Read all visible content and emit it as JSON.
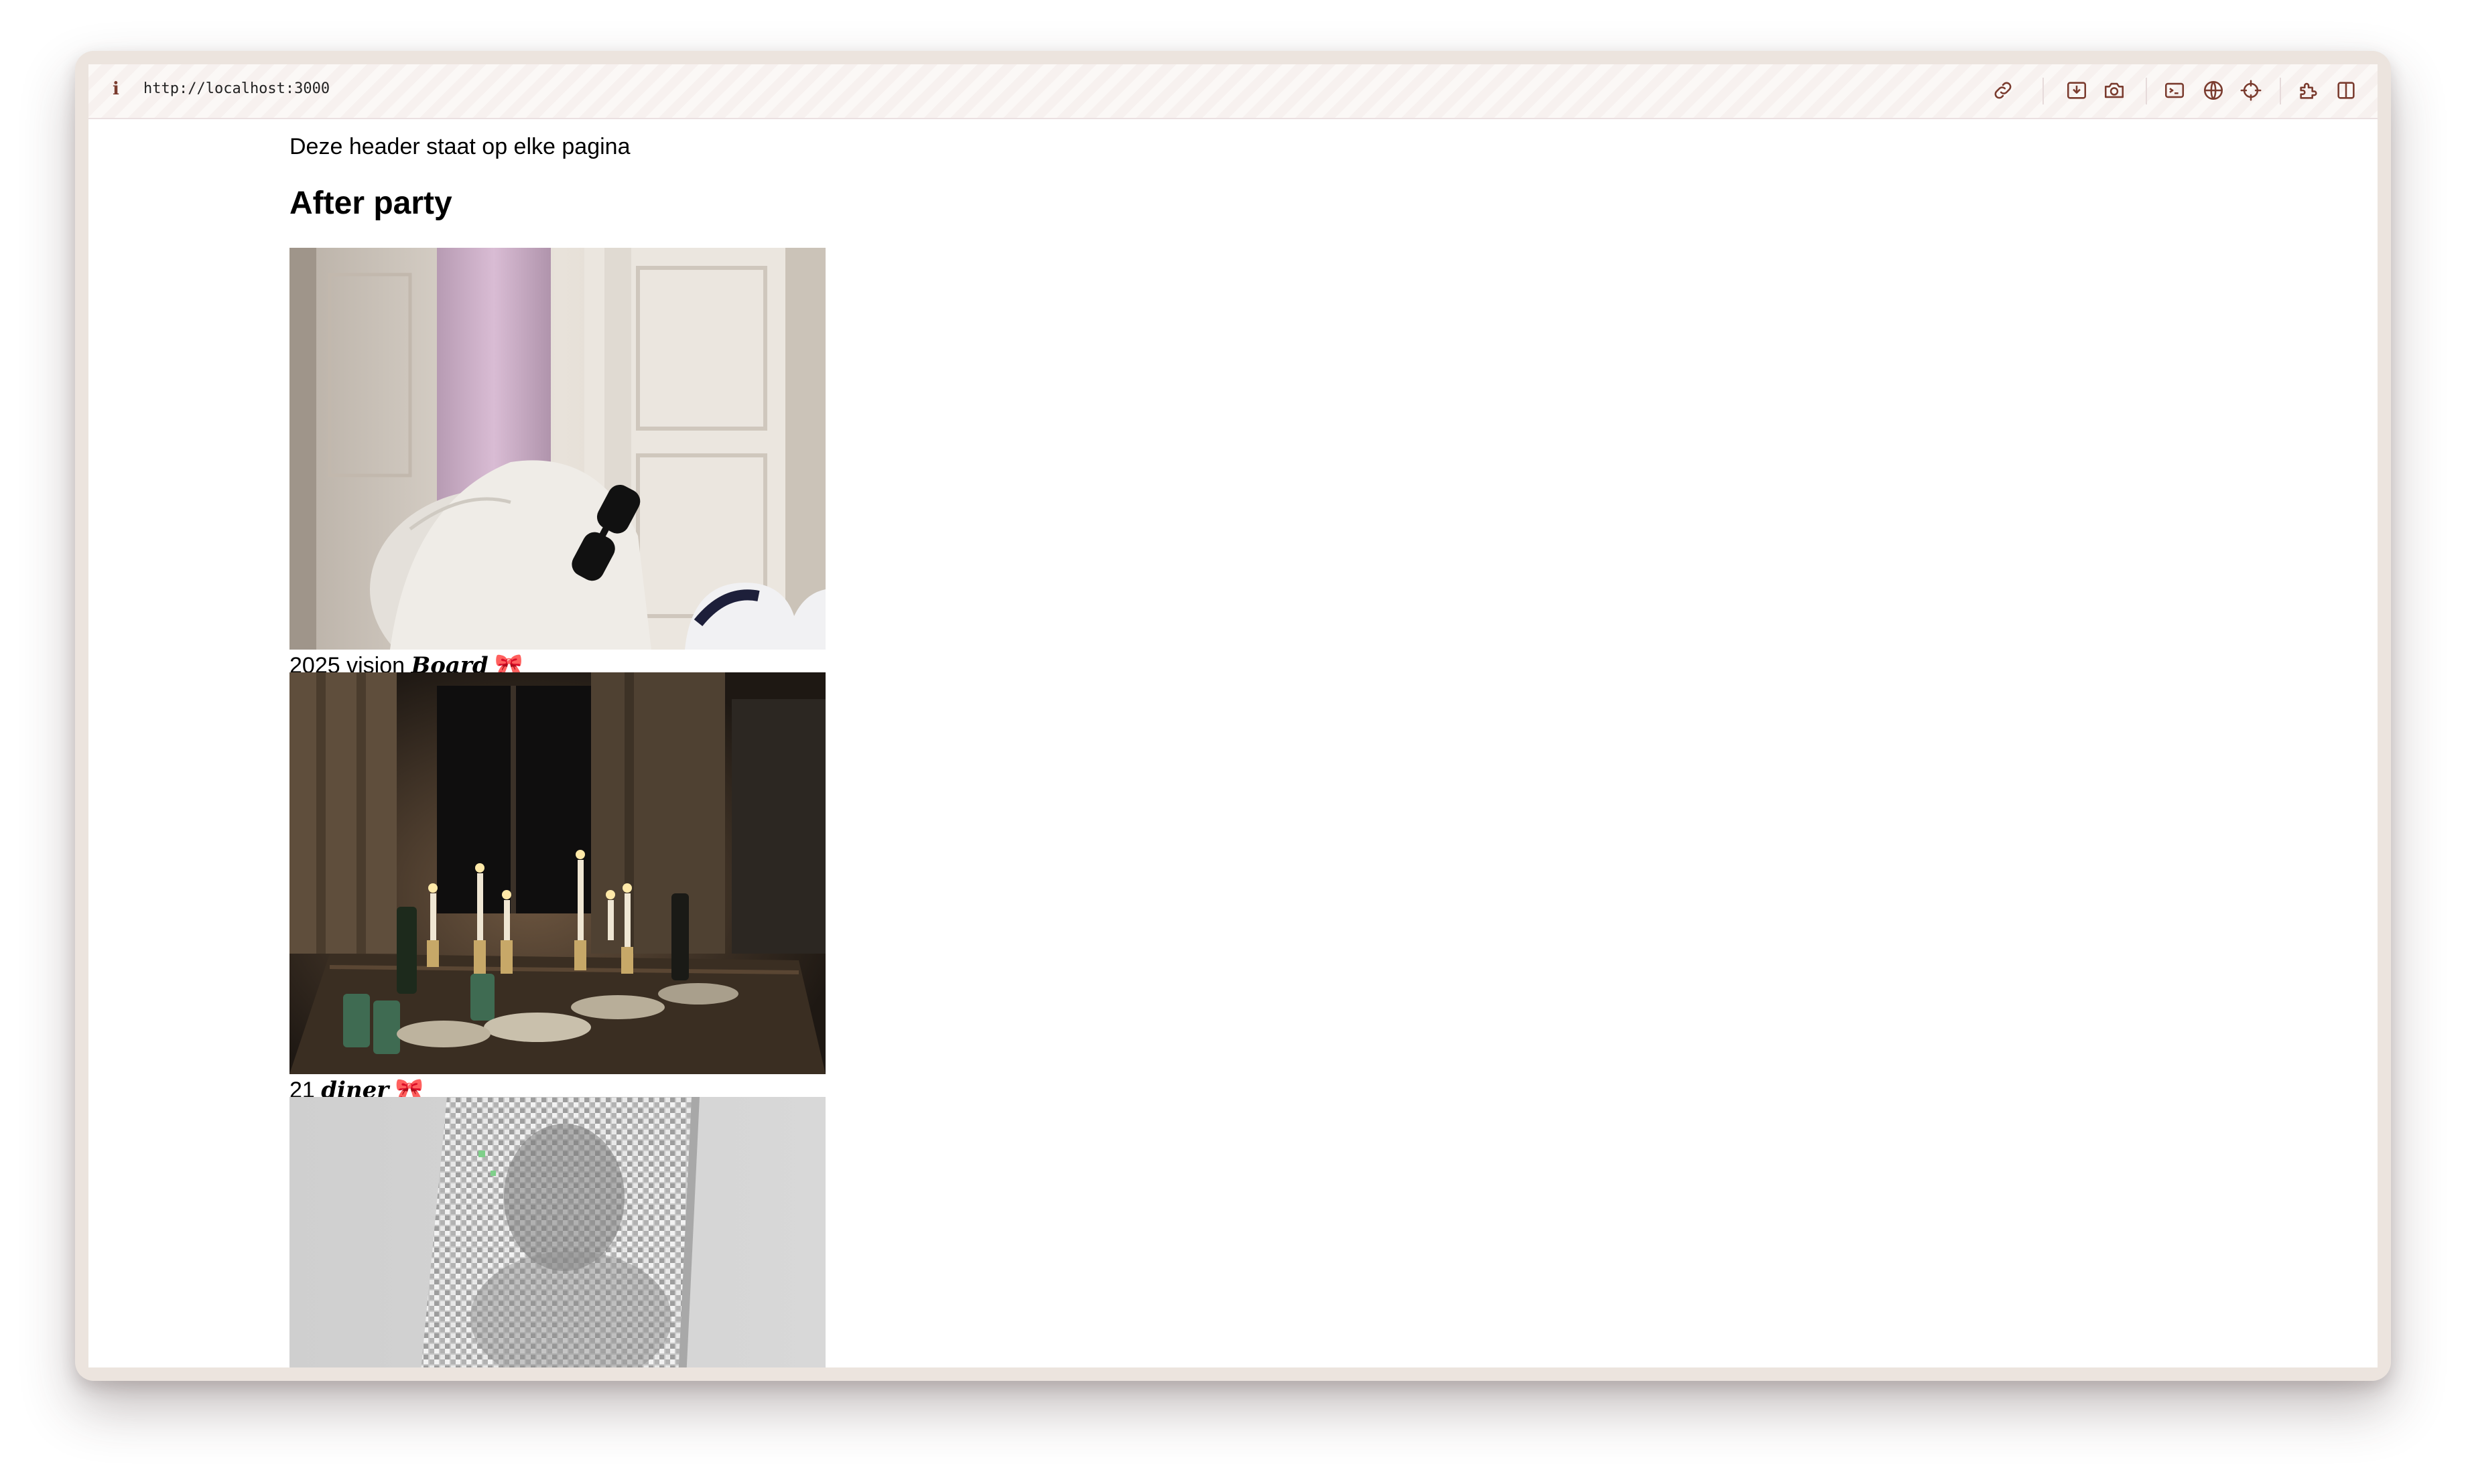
{
  "browser": {
    "info_icon": "i",
    "url": "http://localhost:3000",
    "toolbar_icons": [
      "link-icon",
      "download-icon",
      "camera-icon",
      "terminal-icon",
      "globe-icon",
      "crosshair-icon",
      "extensions-icon",
      "split-view-icon"
    ]
  },
  "page": {
    "header_text": "Deze header staat op elke pagina",
    "title": "After party",
    "posts": [
      {
        "caption_plain": "2025 vision ",
        "caption_fancy": "Board",
        "caption_emoji": "🎀",
        "image": "photo of a pink yoga mat, white tote bag, black sunglasses and sneakers by a white door"
      },
      {
        "caption_plain": "21 ",
        "caption_fancy": "diner",
        "caption_emoji": "🎀",
        "image": "photo of a candlelit dinner table with wine bottles and plates"
      },
      {
        "image": "photo of a mirrored disco mosaic panel leaning against a grey wall"
      }
    ]
  },
  "colors": {
    "toolbar_icon": "#7a3b2e",
    "frame": "#ece4de"
  }
}
